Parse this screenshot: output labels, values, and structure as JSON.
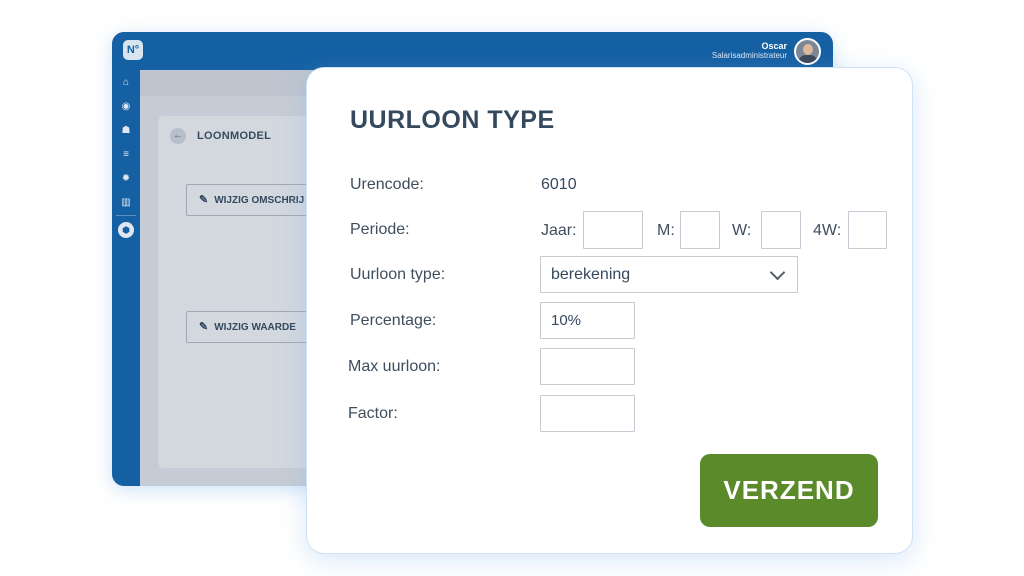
{
  "app": {
    "logo": "N°",
    "user": {
      "name": "Oscar",
      "role": "Salarisadministrateur"
    },
    "sidebar": [
      {
        "icon": "home-icon",
        "glyph": "⌂"
      },
      {
        "icon": "compass-icon",
        "glyph": "◉"
      },
      {
        "icon": "users-icon",
        "glyph": "☗"
      },
      {
        "icon": "list-icon",
        "glyph": "≡"
      },
      {
        "icon": "gear-icon",
        "glyph": "✹"
      },
      {
        "icon": "chart-icon",
        "glyph": "▥"
      },
      {
        "icon": "lock-icon",
        "glyph": "⬢"
      }
    ],
    "card": {
      "back_glyph": "←",
      "title": "LOONMODEL",
      "buttons": [
        {
          "label": "WIJZIG OMSCHRIJ"
        },
        {
          "label": "WIJZIG WAARDE"
        }
      ],
      "pencil_glyph": "✎"
    }
  },
  "modal": {
    "title": "UURLOON TYPE",
    "fields": {
      "urencode": {
        "label": "Urencode:",
        "value": "6010"
      },
      "periode": {
        "label": "Periode:",
        "jaar_label": "Jaar:",
        "jaar_value": "",
        "m_label": "M:",
        "m_value": "",
        "w_label": "W:",
        "w_value": "",
        "w4_label": "4W:",
        "w4_value": ""
      },
      "uurloon_type": {
        "label": "Uurloon type:",
        "value": "berekening"
      },
      "percentage": {
        "label": "Percentage:",
        "value": "10%"
      },
      "max_uurloon": {
        "label": "Max uurloon:",
        "value": ""
      },
      "factor": {
        "label": "Factor:",
        "value": ""
      }
    },
    "submit_label": "VERZEND"
  },
  "colors": {
    "brand_blue": "#1560a3",
    "submit_green": "#5a8a29",
    "title_text": "#34495e"
  }
}
